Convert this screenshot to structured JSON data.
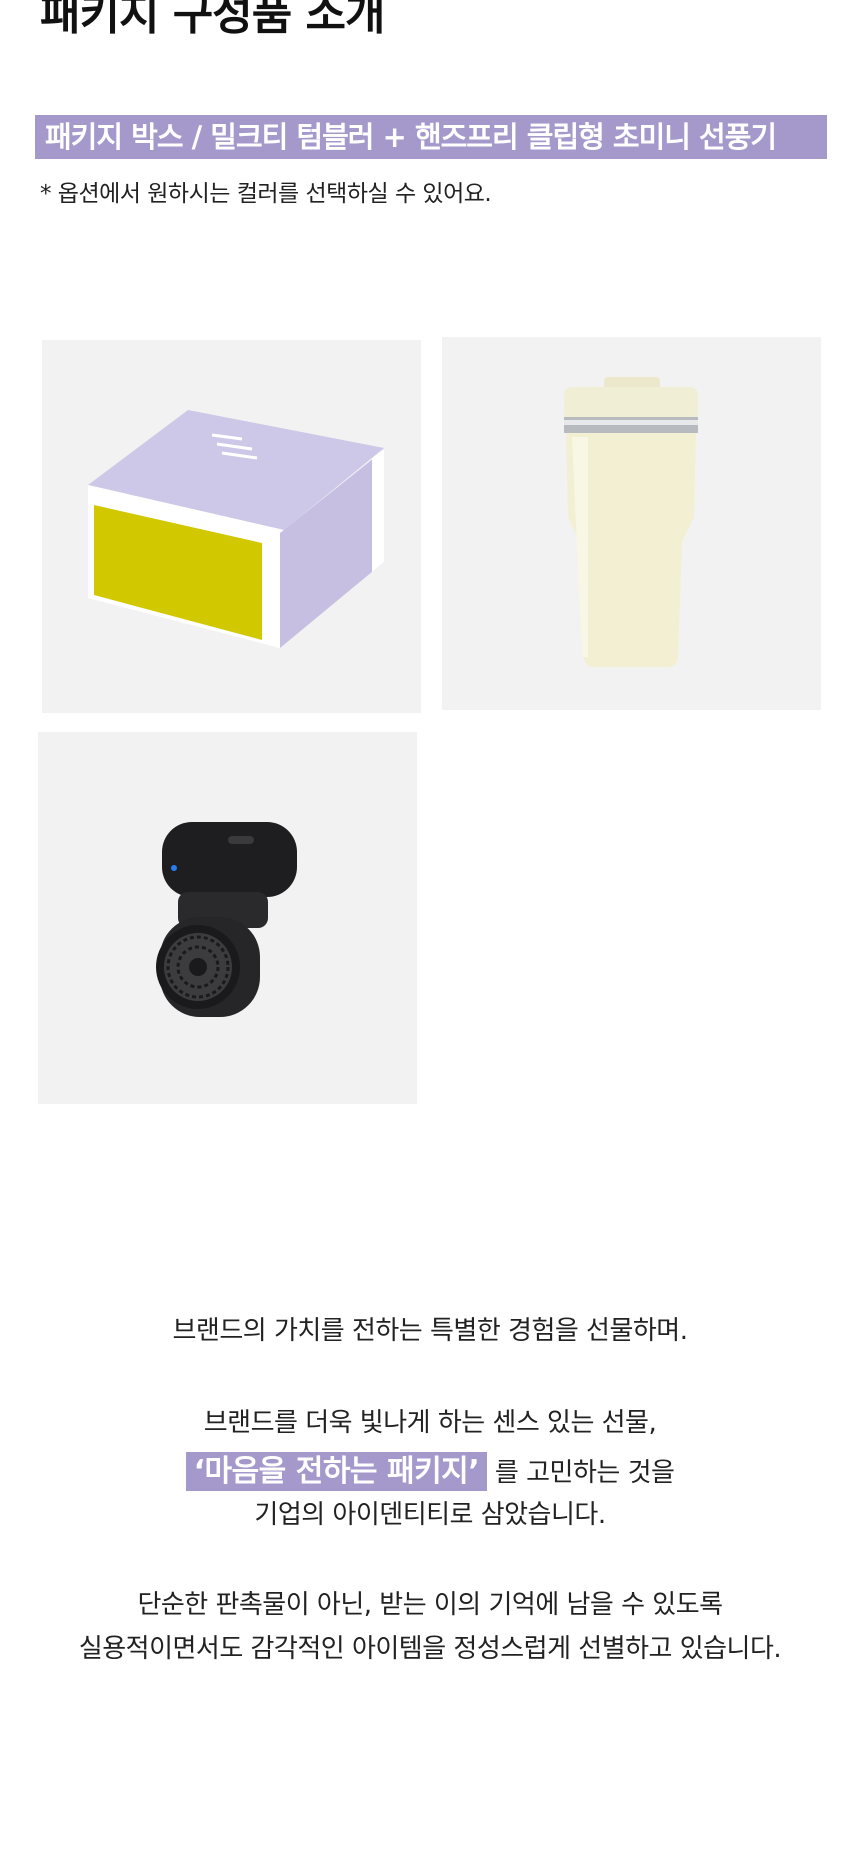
{
  "header": {
    "section_title": "패키지 구성품 소개"
  },
  "package": {
    "banner": "패키지 박스 / 밀크티 텀블러 + 핸즈프리 클립형 초미니 선풍기",
    "note": "* 옵션에서 원하시는 컬러를 선택하실 수 있어요."
  },
  "products": [
    {
      "name": "package-box",
      "colors": {
        "box_top": "#c9c2e6",
        "box_side": "#d4c800"
      }
    },
    {
      "name": "milktea-tumbler",
      "colors": {
        "body": "#f3efd2",
        "band": "#b8bcc0"
      }
    },
    {
      "name": "clip-mini-fan",
      "colors": {
        "body": "#1c1c1e",
        "indicator": "#2a7df0"
      }
    }
  ],
  "description": {
    "line1": "브랜드의 가치를 전하는  특별한 경험을 선물하며.",
    "line2": "브랜드를 더욱 빛나게 하는 센스 있는 선물,",
    "highlight": "‘마음을 전하는 패키지’",
    "line3_suffix": " 를 고민하는 것을",
    "line4": "기업의 아이덴티티로 삼았습니다.",
    "line5": "단순한 판촉물이 아닌, 받는 이의 기억에 남을 수 있도록",
    "line6": "실용적이면서도 감각적인 아이템을 정성스럽게 선별하고 있습니다."
  },
  "theme": {
    "accent": "#a599cc",
    "photo_bg": "#f2f2f2"
  }
}
